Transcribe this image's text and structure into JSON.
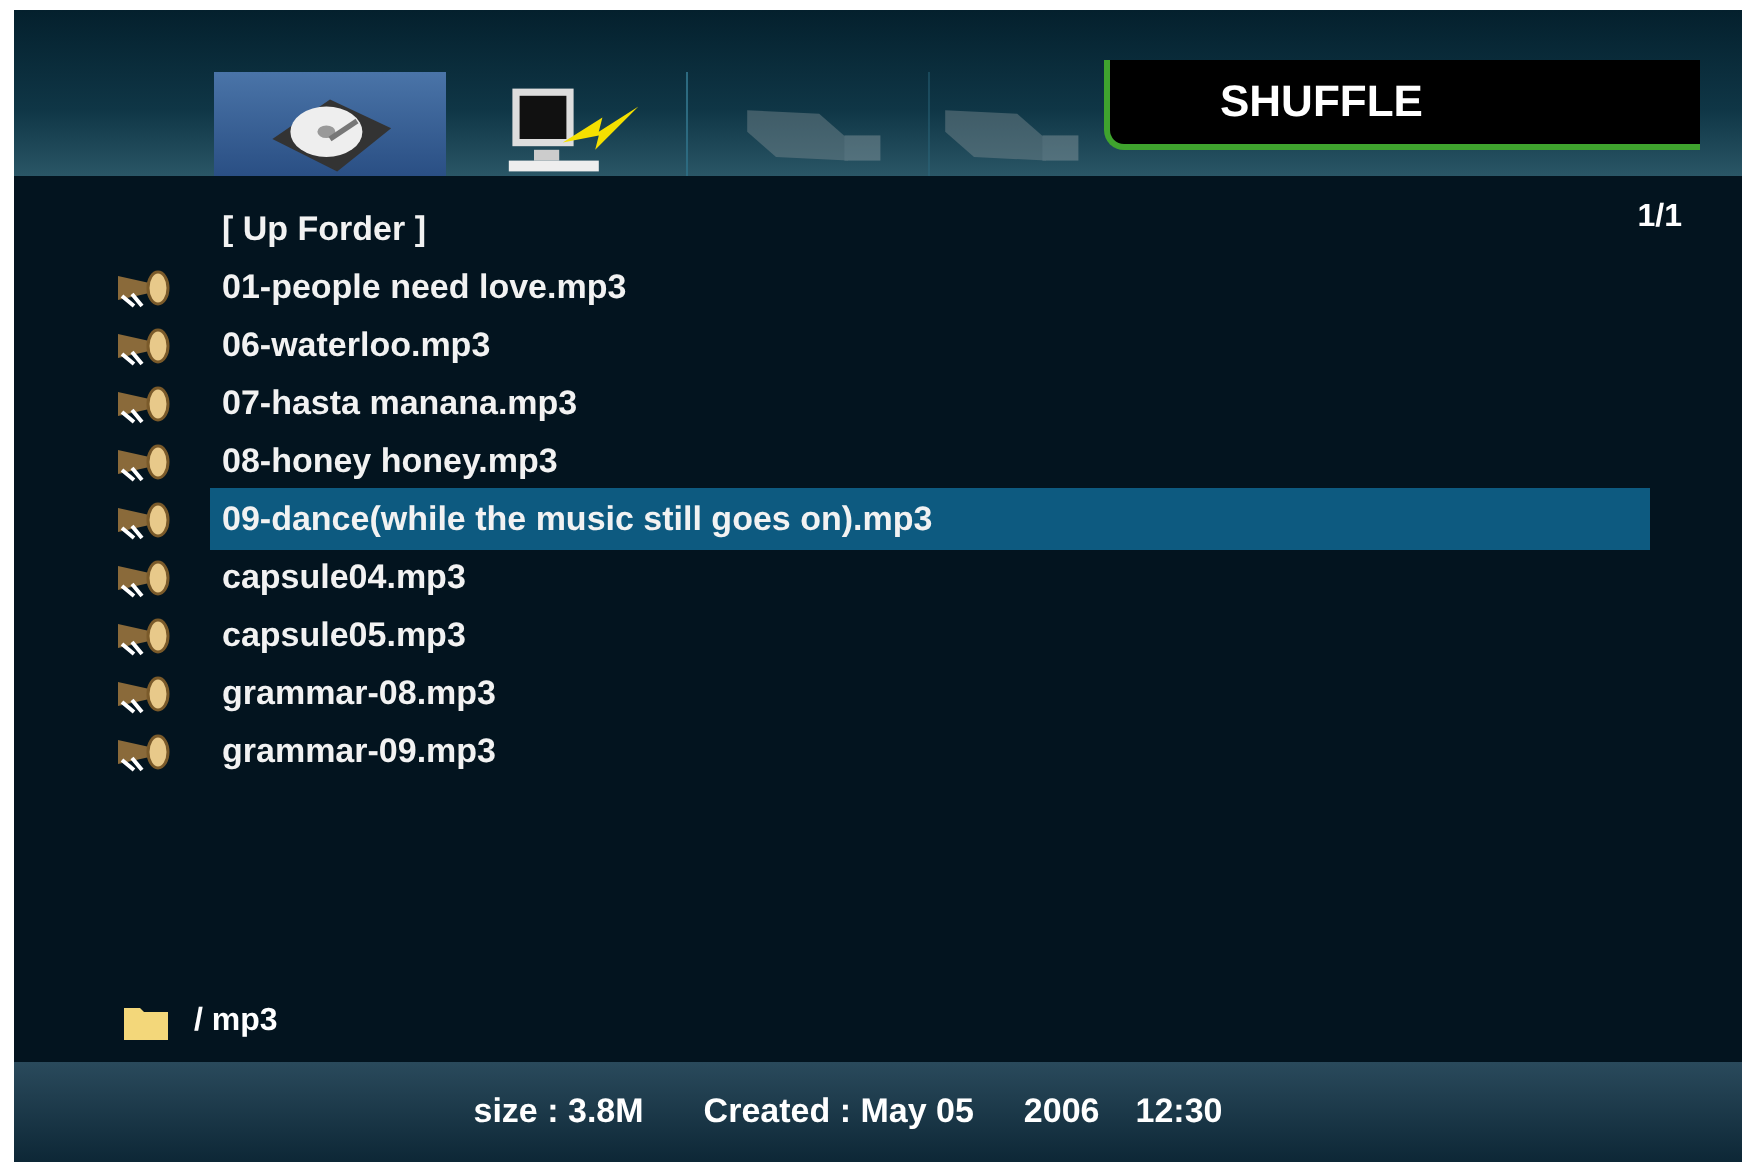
{
  "tabs": [
    {
      "kind": "hard-drive",
      "selected": true,
      "disabled": false
    },
    {
      "kind": "network",
      "selected": false,
      "disabled": false
    },
    {
      "kind": "usb",
      "selected": false,
      "disabled": true
    },
    {
      "kind": "usb",
      "selected": false,
      "disabled": true
    }
  ],
  "mode_badge": "SHUFFLE",
  "page_indicator": "1/1",
  "list": {
    "up_folder": "[ Up Forder ]",
    "files": [
      {
        "name": "01-people need love.mp3",
        "selected": false
      },
      {
        "name": "06-waterloo.mp3",
        "selected": false
      },
      {
        "name": "07-hasta manana.mp3",
        "selected": false
      },
      {
        "name": "08-honey honey.mp3",
        "selected": false
      },
      {
        "name": "09-dance(while the music still goes on).mp3",
        "selected": true
      },
      {
        "name": "capsule04.mp3",
        "selected": false
      },
      {
        "name": "capsule05.mp3",
        "selected": false
      },
      {
        "name": "grammar-08.mp3",
        "selected": false
      },
      {
        "name": "grammar-09.mp3",
        "selected": false
      }
    ]
  },
  "path": "/ mp3",
  "status_bar": {
    "size": "size : 3.8M",
    "created": "Created : May 05",
    "year": "2006",
    "time": "12:30"
  }
}
